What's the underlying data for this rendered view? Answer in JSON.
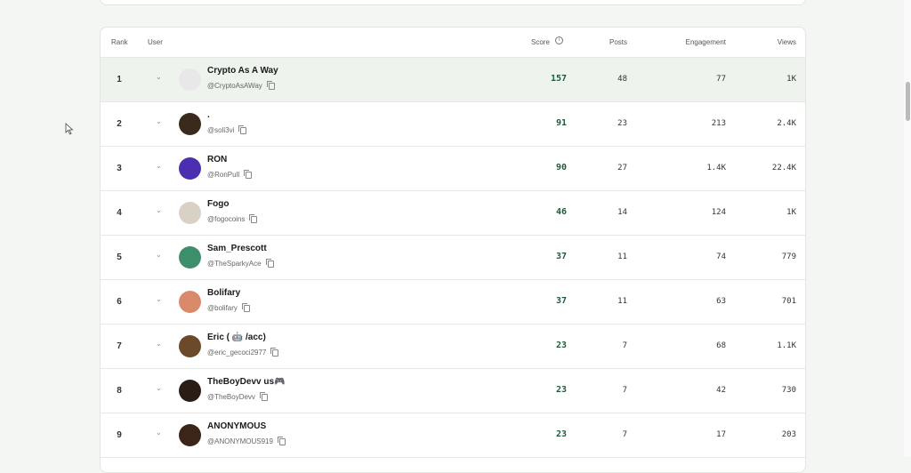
{
  "header": {
    "rank": "Rank",
    "user": "User",
    "score": "Score",
    "posts": "Posts",
    "engagement": "Engagement",
    "views": "Views",
    "info_icon": "info-icon"
  },
  "rows": [
    {
      "rank": "1",
      "name": "Crypto As A Way",
      "handle": "@CryptoAsAWay",
      "score": "157",
      "posts": "48",
      "engagement": "77",
      "views": "1K",
      "avatar_color": "#e8e8e8",
      "highlight": true
    },
    {
      "rank": "2",
      "name": ".",
      "handle": "@soli3vi",
      "score": "91",
      "posts": "23",
      "engagement": "213",
      "views": "2.4K",
      "avatar_color": "#3a2a1c"
    },
    {
      "rank": "3",
      "name": "RON",
      "handle": "@RonPull",
      "score": "90",
      "posts": "27",
      "engagement": "1.4K",
      "views": "22.4K",
      "avatar_color": "#4b2fb0"
    },
    {
      "rank": "4",
      "name": "Fogo",
      "handle": "@fogocoins",
      "score": "46",
      "posts": "14",
      "engagement": "124",
      "views": "1K",
      "avatar_color": "#d9d2c4"
    },
    {
      "rank": "5",
      "name": "Sam_Prescott",
      "handle": "@TheSparkyAce",
      "score": "37",
      "posts": "11",
      "engagement": "74",
      "views": "779",
      "avatar_color": "#3c8f6a"
    },
    {
      "rank": "6",
      "name": "Bolifary",
      "handle": "@bolifary",
      "score": "37",
      "posts": "11",
      "engagement": "63",
      "views": "701",
      "avatar_color": "#d98a6a"
    },
    {
      "rank": "7",
      "name": "Eric ( 🤖 /acc)",
      "handle": "@eric_gecoci2977",
      "score": "23",
      "posts": "7",
      "engagement": "68",
      "views": "1.1K",
      "avatar_color": "#6b4a2a"
    },
    {
      "rank": "8",
      "name": "TheBoyDevv us🎮",
      "handle": "@TheBoyDevv",
      "score": "23",
      "posts": "7",
      "engagement": "42",
      "views": "730",
      "avatar_color": "#2a1d15"
    },
    {
      "rank": "9",
      "name": "ANONYMOUS",
      "handle": "@ANONYMOUS919",
      "score": "23",
      "posts": "7",
      "engagement": "17",
      "views": "203",
      "avatar_color": "#3b2418"
    }
  ]
}
